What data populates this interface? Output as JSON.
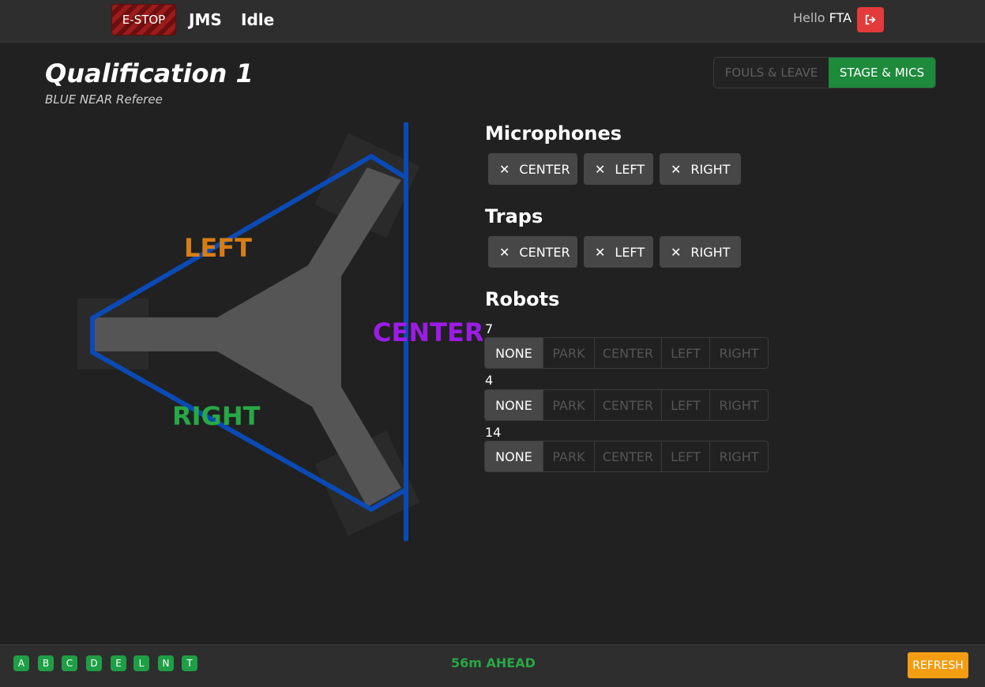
{
  "nav": {
    "estop_label": "E-STOP",
    "brand": "JMS",
    "status": "Idle",
    "hello_prefix": "Hello",
    "user": "FTA",
    "logout_icon": "logout-icon"
  },
  "header": {
    "title": "Qualification 1",
    "subtitle": "BLUE NEAR Referee",
    "tabs": [
      {
        "label": "FOULS & LEAVE",
        "active": false
      },
      {
        "label": "STAGE & MICS",
        "active": true
      }
    ]
  },
  "field": {
    "labels": {
      "left": "LEFT",
      "right": "RIGHT",
      "center": "CENTER"
    },
    "colors": {
      "outline": "#0a4ab5",
      "stage": "#555555",
      "left": "#d77d14",
      "right": "#27a845",
      "center": "#9d1be7"
    }
  },
  "microphones": {
    "title": "Microphones",
    "items": [
      "CENTER",
      "LEFT",
      "RIGHT"
    ]
  },
  "traps": {
    "title": "Traps",
    "items": [
      "CENTER",
      "LEFT",
      "RIGHT"
    ]
  },
  "robots": {
    "title": "Robots",
    "options": [
      "NONE",
      "PARK",
      "CENTER",
      "LEFT",
      "RIGHT"
    ],
    "teams": [
      {
        "number": "7",
        "selected": "NONE"
      },
      {
        "number": "4",
        "selected": "NONE"
      },
      {
        "number": "14",
        "selected": "NONE"
      }
    ]
  },
  "footer": {
    "status_dots": [
      "A",
      "B",
      "C",
      "D",
      "E",
      "L",
      "N",
      "T"
    ],
    "ahead_text": "56m AHEAD",
    "refresh_label": "REFRESH"
  }
}
